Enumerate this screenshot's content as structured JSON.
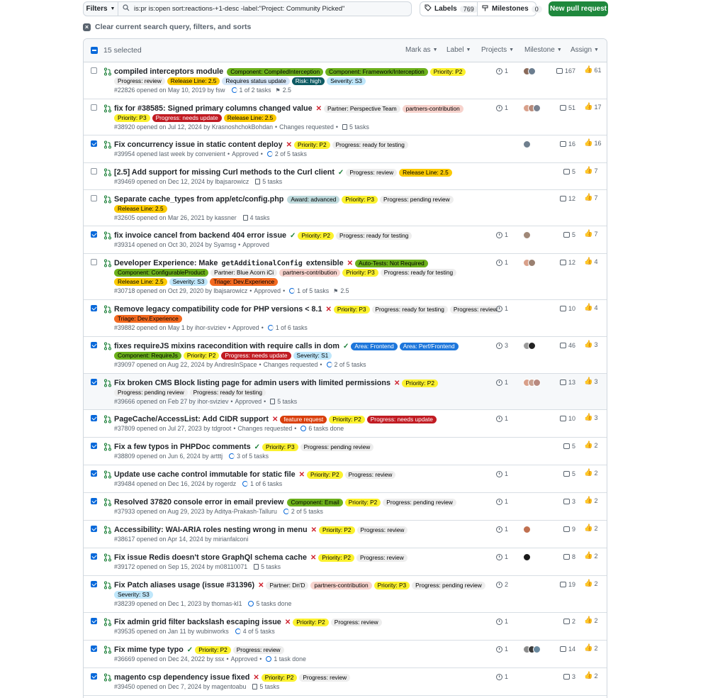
{
  "toolbar": {
    "filters_label": "Filters",
    "search_value": "is:pr is:open sort:reactions-+1-desc -label:\"Project: Community Picked\"",
    "labels_label": "Labels",
    "labels_count": "769",
    "milestones_label": "Milestones",
    "milestones_count": "0",
    "new_pr_label": "New pull request",
    "clear_query_label": "Clear current search query, filters, and sorts"
  },
  "list_header": {
    "selected_text": "15 selected",
    "mark_as": "Mark as",
    "label": "Label",
    "projects": "Projects",
    "milestone": "Milestone",
    "assign": "Assign"
  },
  "colors": {
    "accent": "#0969da",
    "pr_open": "#1a7f37",
    "new_pr_button": "#1f883d"
  },
  "rows": [
    {
      "checked": false,
      "title": "compiled interceptors module",
      "status": "",
      "label_lines": [
        [
          {
            "t": "Component: CompiledInterception",
            "bg": "#6cb01c",
            "fg": "#000"
          },
          {
            "t": "Component: Framework/Interception",
            "bg": "#6cb01c",
            "fg": "#000"
          },
          {
            "t": "Priority: P2",
            "bg": "#fbf12e",
            "fg": "#000"
          }
        ],
        [
          {
            "t": "Progress: review",
            "bg": "#ededed",
            "fg": "#000"
          },
          {
            "t": "Release Line: 2.5",
            "bg": "#fbca04",
            "fg": "#000"
          },
          {
            "t": "Requires status update",
            "bg": "#d4e5f7",
            "fg": "#000"
          },
          {
            "t": "Risk: high",
            "bg": "#0e5b63",
            "fg": "#fff"
          },
          {
            "t": "Severity: S3",
            "bg": "#bfe7fb",
            "fg": "#000"
          }
        ]
      ],
      "meta": "#22826 opened on May 10, 2019 by fsw",
      "approval": "",
      "tasks": "1 of 2 tasks",
      "task_kind": "ring",
      "milestone": "2.5",
      "linked": "1",
      "avatars": [
        "#8a6a5a",
        "#6b7d8f"
      ],
      "comments": "167",
      "reactions": "61"
    },
    {
      "checked": false,
      "title": "fix for #38585: Signed primary columns changed value",
      "status": "x",
      "label_lines": [
        [
          {
            "t": "Partner: Perspective Team",
            "bg": "#ededed",
            "fg": "#000"
          },
          {
            "t": "partners-contribution",
            "bg": "#f7d3cd",
            "fg": "#000"
          }
        ],
        [
          {
            "t": "Priority: P3",
            "bg": "#fbf12e",
            "fg": "#000"
          },
          {
            "t": "Progress: needs update",
            "bg": "#c11b22",
            "fg": "#fff"
          },
          {
            "t": "Release Line: 2.5",
            "bg": "#fbca04",
            "fg": "#000"
          }
        ]
      ],
      "meta": "#38920 opened on Jul 12, 2024 by KrasnoshchokBohdan",
      "approval": "Changes requested",
      "tasks": "5 tasks",
      "task_kind": "list",
      "milestone": "",
      "linked": "1",
      "avatars": [
        "#d9a08a",
        "#b78a7a",
        "#7a8290"
      ],
      "comments": "51",
      "reactions": "17"
    },
    {
      "checked": true,
      "title": "Fix concurrency issue in static content deploy",
      "status": "x",
      "label_lines": [
        [
          {
            "t": "Priority: P2",
            "bg": "#fbf12e",
            "fg": "#000"
          },
          {
            "t": "Progress: ready for testing",
            "bg": "#ededed",
            "fg": "#000"
          }
        ]
      ],
      "meta": "#39954 opened last week by convenient",
      "approval": "Approved",
      "tasks": "2 of 5 tasks",
      "task_kind": "ring",
      "milestone": "",
      "linked": "",
      "avatars": [
        "#6f7f8e"
      ],
      "comments": "16",
      "reactions": "16"
    },
    {
      "checked": false,
      "title": "[2.5] Add support for missing Curl methods to the Curl client",
      "status": "ok",
      "label_lines": [
        [
          {
            "t": "Progress: review",
            "bg": "#ededed",
            "fg": "#000"
          },
          {
            "t": "Release Line: 2.5",
            "bg": "#fbca04",
            "fg": "#000"
          }
        ]
      ],
      "meta": "#39469 opened on Dec 12, 2024 by lbajsarowicz",
      "approval": "",
      "tasks": "5 tasks",
      "task_kind": "list",
      "milestone": "",
      "linked": "",
      "avatars": [],
      "comments": "5",
      "reactions": "7"
    },
    {
      "checked": false,
      "title": "Separate cache_types from app/etc/config.php",
      "status": "",
      "label_lines": [
        [
          {
            "t": "Award: advanced",
            "bg": "#bfdadc",
            "fg": "#000"
          },
          {
            "t": "Priority: P3",
            "bg": "#fbf12e",
            "fg": "#000"
          },
          {
            "t": "Progress: pending review",
            "bg": "#ededed",
            "fg": "#000"
          }
        ],
        [
          {
            "t": "Release Line: 2.5",
            "bg": "#fbca04",
            "fg": "#000"
          }
        ]
      ],
      "meta": "#32605 opened on Mar 26, 2021 by kassner",
      "approval": "",
      "tasks": "4 tasks",
      "task_kind": "list",
      "milestone": "",
      "linked": "",
      "avatars": [],
      "comments": "12",
      "reactions": "7"
    },
    {
      "checked": true,
      "title": "fix invoice cancel from backend 404 error issue",
      "status": "ok",
      "label_lines": [
        [
          {
            "t": "Priority: P2",
            "bg": "#fbf12e",
            "fg": "#000"
          },
          {
            "t": "Progress: ready for testing",
            "bg": "#ededed",
            "fg": "#000"
          }
        ]
      ],
      "meta": "#39314 opened on Oct 30, 2024 by Syamsg",
      "approval": "Approved",
      "tasks": "",
      "task_kind": "",
      "milestone": "",
      "linked": "1",
      "avatars": [
        "#a08878"
      ],
      "comments": "5",
      "reactions": "7"
    },
    {
      "checked": false,
      "title": "Developer Experience: Make ",
      "title_code": "getAdditionalConfig",
      "title_tail": " extensible",
      "status": "x",
      "label_lines": [
        [
          {
            "t": "Auto-Tests: Not Required",
            "bg": "#6cb01c",
            "fg": "#000"
          }
        ],
        [
          {
            "t": "Component: ConfigurableProduct",
            "bg": "#6cb01c",
            "fg": "#000"
          },
          {
            "t": "Partner: Blue Acorn iCi",
            "bg": "#ededed",
            "fg": "#000"
          },
          {
            "t": "partners-contribution",
            "bg": "#f7d3cd",
            "fg": "#000"
          },
          {
            "t": "Priority: P3",
            "bg": "#fbf12e",
            "fg": "#000"
          },
          {
            "t": "Progress: ready for testing",
            "bg": "#ededed",
            "fg": "#000"
          }
        ],
        [
          {
            "t": "Release Line: 2.5",
            "bg": "#fbca04",
            "fg": "#000"
          },
          {
            "t": "Severity: S3",
            "bg": "#bfe7fb",
            "fg": "#000"
          },
          {
            "t": "Triage: Dev.Experience",
            "bg": "#f36a21",
            "fg": "#000"
          }
        ]
      ],
      "meta": "#30718 opened on Oct 29, 2020 by lbajsarowicz",
      "approval": "Approved",
      "tasks": "1 of 5 tasks",
      "task_kind": "ring",
      "milestone": "2.5",
      "linked": "1",
      "avatars": [
        "#d9a08a",
        "#9a8070"
      ],
      "comments": "12",
      "reactions": "4"
    },
    {
      "checked": true,
      "title": "Remove legacy compatibility code for PHP versions < 8.1",
      "status": "x",
      "label_lines": [
        [
          {
            "t": "Priority: P3",
            "bg": "#fbf12e",
            "fg": "#000"
          },
          {
            "t": "Progress: ready for testing",
            "bg": "#ededed",
            "fg": "#000"
          },
          {
            "t": "Progress: review",
            "bg": "#ededed",
            "fg": "#000"
          }
        ],
        [
          {
            "t": "Triage: Dev.Experience",
            "bg": "#f36a21",
            "fg": "#000"
          }
        ]
      ],
      "meta": "#39882 opened on May 1 by ihor-sviziev",
      "approval": "Approved",
      "tasks": "1 of 6 tasks",
      "task_kind": "ring",
      "milestone": "",
      "linked": "1",
      "avatars": [],
      "comments": "10",
      "reactions": "4"
    },
    {
      "checked": true,
      "title": "fixes requireJS mixins racecondition with require calls in dom",
      "status": "ok",
      "label_lines": [
        [
          {
            "t": "Area: Frontend",
            "bg": "#1d76db",
            "fg": "#fff"
          },
          {
            "t": "Area: Perf/Frontend",
            "bg": "#1d76db",
            "fg": "#fff"
          }
        ],
        [
          {
            "t": "Component: RequireJs",
            "bg": "#6cb01c",
            "fg": "#000"
          },
          {
            "t": "Priority: P2",
            "bg": "#fbf12e",
            "fg": "#000"
          },
          {
            "t": "Progress: needs update",
            "bg": "#c11b22",
            "fg": "#fff"
          },
          {
            "t": "Severity: S1",
            "bg": "#bfe7fb",
            "fg": "#000"
          }
        ]
      ],
      "meta": "#39097 opened on Aug 22, 2024 by AndresInSpace",
      "approval": "Changes requested",
      "tasks": "2 of 5 tasks",
      "task_kind": "ring",
      "milestone": "",
      "linked": "3",
      "avatars": [
        "#9a9a9a",
        "#222222"
      ],
      "comments": "46",
      "reactions": "3"
    },
    {
      "checked": true,
      "hl": true,
      "title": "Fix broken CMS Block listing page for admin users with limited permissions",
      "status": "x",
      "label_lines": [
        [
          {
            "t": "Priority: P2",
            "bg": "#fbf12e",
            "fg": "#000"
          }
        ],
        [
          {
            "t": "Progress: pending review",
            "bg": "#ededed",
            "fg": "#000"
          },
          {
            "t": "Progress: ready for testing",
            "bg": "#ededed",
            "fg": "#000"
          }
        ]
      ],
      "meta": "#39666 opened on Feb 27 by ihor-sviziev",
      "approval": "Approved",
      "tasks": "5 tasks",
      "task_kind": "list",
      "milestone": "",
      "linked": "1",
      "avatars": [
        "#d9a08a",
        "#c8a090",
        "#b88a80"
      ],
      "comments": "13",
      "reactions": "3"
    },
    {
      "checked": true,
      "title": "PageCache/AccessList: Add CIDR support",
      "status": "x",
      "label_lines": [
        [
          {
            "t": "feature request",
            "bg": "#d93f0b",
            "fg": "#fff"
          },
          {
            "t": "Priority: P2",
            "bg": "#fbf12e",
            "fg": "#000"
          },
          {
            "t": "Progress: needs update",
            "bg": "#c11b22",
            "fg": "#fff"
          }
        ]
      ],
      "meta": "#37809 opened on Jul 27, 2023 by tdgroot",
      "approval": "Changes requested",
      "tasks": "6 tasks done",
      "task_kind": "done",
      "milestone": "",
      "linked": "1",
      "avatars": [],
      "comments": "10",
      "reactions": "3"
    },
    {
      "checked": true,
      "title": "Fix a few typos in PHPDoc comments",
      "status": "ok",
      "label_lines": [
        [
          {
            "t": "Priority: P3",
            "bg": "#fbf12e",
            "fg": "#000"
          },
          {
            "t": "Progress: pending review",
            "bg": "#ededed",
            "fg": "#000"
          }
        ]
      ],
      "meta": "#38809 opened on Jun 6, 2024 by artttj",
      "approval": "",
      "tasks": "3 of 5 tasks",
      "task_kind": "ring",
      "milestone": "",
      "linked": "",
      "avatars": [],
      "comments": "5",
      "reactions": "2"
    },
    {
      "checked": true,
      "title": "Update use cache control immutable for static file",
      "status": "x",
      "label_lines": [
        [
          {
            "t": "Priority: P2",
            "bg": "#fbf12e",
            "fg": "#000"
          },
          {
            "t": "Progress: review",
            "bg": "#ededed",
            "fg": "#000"
          }
        ]
      ],
      "meta": "#39484 opened on Dec 16, 2024 by rogerdz",
      "approval": "",
      "tasks": "1 of 6 tasks",
      "task_kind": "ring",
      "milestone": "",
      "linked": "1",
      "avatars": [],
      "comments": "5",
      "reactions": "2"
    },
    {
      "checked": true,
      "title": "Resolved 37820 console error in email preview",
      "status": "",
      "label_lines": [
        [
          {
            "t": "Component: Email",
            "bg": "#6cb01c",
            "fg": "#000"
          },
          {
            "t": "Priority: P2",
            "bg": "#fbf12e",
            "fg": "#000"
          },
          {
            "t": "Progress: pending review",
            "bg": "#ededed",
            "fg": "#000"
          }
        ]
      ],
      "meta": "#37933 opened on Aug 29, 2023 by Aditya-Prakash-Talluru",
      "approval": "",
      "tasks": "2 of 5 tasks",
      "task_kind": "ring",
      "milestone": "",
      "linked": "1",
      "avatars": [],
      "comments": "3",
      "reactions": "2"
    },
    {
      "checked": true,
      "title": "Accessibility: WAI-ARIA roles nesting wrong in menu",
      "status": "x",
      "label_lines": [
        [
          {
            "t": "Priority: P2",
            "bg": "#fbf12e",
            "fg": "#000"
          },
          {
            "t": "Progress: review",
            "bg": "#ededed",
            "fg": "#000"
          }
        ]
      ],
      "meta": "#38617 opened on Apr 14, 2024 by mirianfalconi",
      "approval": "",
      "tasks": "",
      "task_kind": "",
      "milestone": "",
      "linked": "1",
      "avatars": [
        "#c07050"
      ],
      "comments": "9",
      "reactions": "2"
    },
    {
      "checked": true,
      "title": "Fix issue Redis doesn't store GraphQl schema cache",
      "status": "x",
      "label_lines": [
        [
          {
            "t": "Priority: P2",
            "bg": "#fbf12e",
            "fg": "#000"
          },
          {
            "t": "Progress: review",
            "bg": "#ededed",
            "fg": "#000"
          }
        ]
      ],
      "meta": "#39172 opened on Sep 15, 2024 by m08110071",
      "approval": "",
      "tasks": "5 tasks",
      "task_kind": "list",
      "milestone": "",
      "linked": "1",
      "avatars": [
        "#1a1a1a"
      ],
      "comments": "8",
      "reactions": "2"
    },
    {
      "checked": true,
      "title": "Fix Patch aliases usage (issue #31396)",
      "status": "x",
      "label_lines": [
        [
          {
            "t": "Partner: Dn'D",
            "bg": "#ededed",
            "fg": "#000"
          },
          {
            "t": "partners-contribution",
            "bg": "#f7d3cd",
            "fg": "#000"
          },
          {
            "t": "Priority: P3",
            "bg": "#fbf12e",
            "fg": "#000"
          },
          {
            "t": "Progress: pending review",
            "bg": "#ededed",
            "fg": "#000"
          }
        ],
        [
          {
            "t": "Severity: S3",
            "bg": "#bfe7fb",
            "fg": "#000"
          }
        ]
      ],
      "meta": "#38239 opened on Dec 1, 2023 by thomas-kl1",
      "approval": "",
      "tasks": "5 tasks done",
      "task_kind": "done",
      "milestone": "",
      "linked": "2",
      "avatars": [],
      "comments": "19",
      "reactions": "2"
    },
    {
      "checked": true,
      "title": "Fix admin grid filter backslash escaping issue",
      "status": "x",
      "label_lines": [
        [
          {
            "t": "Priority: P2",
            "bg": "#fbf12e",
            "fg": "#000"
          },
          {
            "t": "Progress: review",
            "bg": "#ededed",
            "fg": "#000"
          }
        ]
      ],
      "meta": "#39535 opened on Jan 11 by wubinworks",
      "approval": "",
      "tasks": "4 of 5 tasks",
      "task_kind": "ring",
      "milestone": "",
      "linked": "1",
      "avatars": [],
      "comments": "2",
      "reactions": "2"
    },
    {
      "checked": true,
      "title": "Fix mime type typo",
      "status": "ok",
      "label_lines": [
        [
          {
            "t": "Priority: P2",
            "bg": "#fbf12e",
            "fg": "#000"
          },
          {
            "t": "Progress: review",
            "bg": "#ededed",
            "fg": "#000"
          }
        ]
      ],
      "meta": "#36669 opened on Dec 24, 2022 by ssx",
      "approval": "Approved",
      "tasks": "1 task done",
      "task_kind": "done",
      "milestone": "",
      "linked": "1",
      "avatars": [
        "#8a8a8a",
        "#3a3a3a",
        "#6a8aa0"
      ],
      "comments": "14",
      "reactions": "2"
    },
    {
      "checked": true,
      "title": "magento csp dependency issue fixed",
      "status": "x",
      "label_lines": [
        [
          {
            "t": "Priority: P2",
            "bg": "#fbf12e",
            "fg": "#000"
          },
          {
            "t": "Progress: review",
            "bg": "#ededed",
            "fg": "#000"
          }
        ]
      ],
      "meta": "#39450 opened on Dec 7, 2024 by magentoabu",
      "approval": "",
      "tasks": "5 tasks",
      "task_kind": "list",
      "milestone": "",
      "linked": "1",
      "avatars": [],
      "comments": "3",
      "reactions": "2"
    }
  ]
}
